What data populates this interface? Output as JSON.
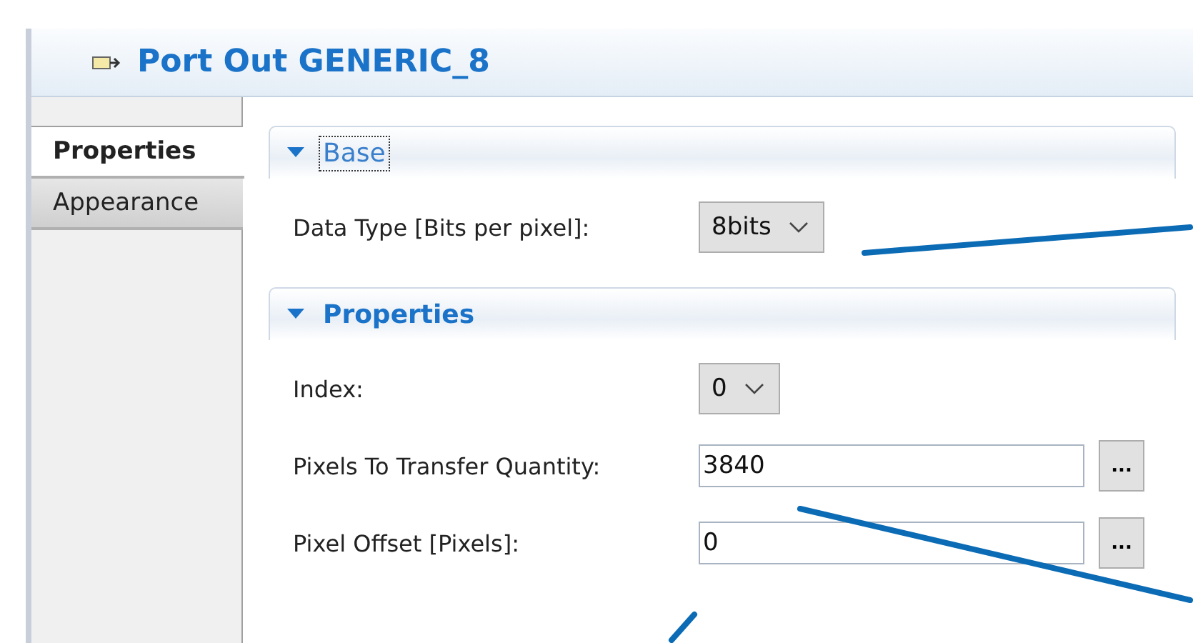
{
  "title": "Port Out GENERIC_8",
  "tabs": [
    {
      "label": "Properties",
      "selected": true
    },
    {
      "label": "Appearance",
      "selected": false
    }
  ],
  "sections": [
    {
      "title": "Base",
      "expanded": true,
      "focused": true,
      "rows": [
        {
          "kind": "dropdown",
          "label": "Data Type [Bits per pixel]:",
          "value": "8bits"
        }
      ]
    },
    {
      "title": "Properties",
      "expanded": true,
      "focused": false,
      "rows": [
        {
          "kind": "dropdown",
          "label": "Index:",
          "value": "0"
        },
        {
          "kind": "text",
          "label": "Pixels To Transfer Quantity:",
          "value": "3840",
          "button": "..."
        },
        {
          "kind": "text",
          "label": "Pixel Offset [Pixels]:",
          "value": "0",
          "button": "..."
        }
      ]
    }
  ]
}
